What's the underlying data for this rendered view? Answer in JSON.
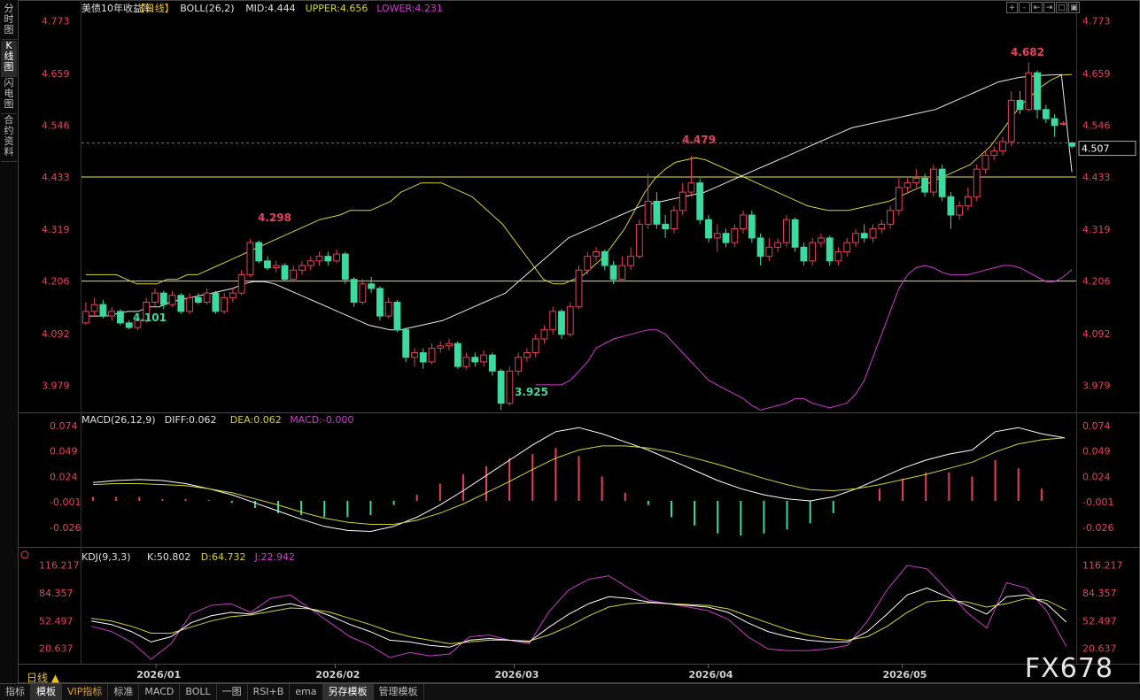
{
  "sidebar": {
    "tabs": [
      "分时图",
      "K线图",
      "闪电图",
      "合约资料"
    ],
    "active": 1
  },
  "main_header": {
    "symbol": "美债10年收益率",
    "period": "【日线】",
    "boll_label": "BOLL(26,2)",
    "mid": "MID:4.444",
    "upper": "UPPER:4.656",
    "lower": "LOWER:4.231"
  },
  "macd_header": {
    "title": "MACD(26,12,9)",
    "diff": "DIFF:0.062",
    "dea": "DEA:0.062",
    "macd": "MACD:-0.000"
  },
  "kdj_header": {
    "title": "KDJ(9,3,3)",
    "k": "K:50.802",
    "d": "D:64.732",
    "j": "J:22.942"
  },
  "toolbar": [
    "+",
    "-",
    "⇤",
    "⇥",
    "□",
    "▣"
  ],
  "price_axis": [
    "4.773",
    "4.659",
    "4.546",
    "4.433",
    "4.319",
    "4.206",
    "4.092",
    "3.979"
  ],
  "macd_axis": [
    "0.074",
    "0.049",
    "0.024",
    "-0.001",
    "-0.026"
  ],
  "kdj_axis": [
    "116.217",
    "84.357",
    "52.497",
    "20.637"
  ],
  "current_price": "4.507",
  "annotations": {
    "high": "4.682",
    "peak_mar": "4.479",
    "peak_jan": "4.298",
    "low_dec": "4.101",
    "low_feb": "3.925"
  },
  "date_labels": [
    "2026/01",
    "2026/02",
    "2026/03",
    "2026/04",
    "2026/05"
  ],
  "bottom_tabs": [
    "指标",
    "模板",
    "VIP指标",
    "标准",
    "MACD",
    "BOLL",
    "一图",
    "RSI+B",
    "ema",
    "另存模板",
    "管理模板"
  ],
  "period_button": "日线 ▲",
  "watermark": "FX678",
  "colors": {
    "up": "#e8405a",
    "down": "#3cd9a0",
    "upper": "#d6d626",
    "mid": "#e8e8e8",
    "lower": "#d03cd0",
    "kdj_j": "#c83cc8",
    "hline": "#e6e640"
  },
  "chart_data": {
    "type": "candlestick",
    "title": "美债10年收益率",
    "period": "日线",
    "ylim": [
      3.92,
      4.78
    ],
    "hlines": [
      4.433,
      4.206
    ],
    "dashed_line": 4.507,
    "candles": [
      [
        4.115,
        4.14,
        4.16,
        4.11
      ],
      [
        4.14,
        4.155,
        4.17,
        4.13
      ],
      [
        4.155,
        4.13,
        4.165,
        4.125
      ],
      [
        4.13,
        4.14,
        4.15,
        4.12
      ],
      [
        4.14,
        4.115,
        4.145,
        4.11
      ],
      [
        4.115,
        4.105,
        4.12,
        4.101
      ],
      [
        4.105,
        4.12,
        4.125,
        4.1
      ],
      [
        4.12,
        4.16,
        4.17,
        4.115
      ],
      [
        4.16,
        4.18,
        4.19,
        4.15
      ],
      [
        4.18,
        4.155,
        4.185,
        4.145
      ],
      [
        4.155,
        4.175,
        4.185,
        4.15
      ],
      [
        4.175,
        4.14,
        4.18,
        4.135
      ],
      [
        4.14,
        4.17,
        4.18,
        4.135
      ],
      [
        4.17,
        4.16,
        4.18,
        4.155
      ],
      [
        4.16,
        4.18,
        4.19,
        4.155
      ],
      [
        4.18,
        4.14,
        4.185,
        4.135
      ],
      [
        4.14,
        4.17,
        4.18,
        4.135
      ],
      [
        4.17,
        4.18,
        4.19,
        4.16
      ],
      [
        4.18,
        4.22,
        4.23,
        4.175
      ],
      [
        4.22,
        4.29,
        4.298,
        4.215
      ],
      [
        4.29,
        4.25,
        4.295,
        4.245
      ],
      [
        4.25,
        4.235,
        4.26,
        4.23
      ],
      [
        4.235,
        4.24,
        4.25,
        4.225
      ],
      [
        4.24,
        4.21,
        4.245,
        4.205
      ],
      [
        4.21,
        4.23,
        4.24,
        4.205
      ],
      [
        4.23,
        4.24,
        4.25,
        4.22
      ],
      [
        4.24,
        4.25,
        4.26,
        4.23
      ],
      [
        4.25,
        4.26,
        4.27,
        4.24
      ],
      [
        4.26,
        4.25,
        4.27,
        4.24
      ],
      [
        4.25,
        4.265,
        4.275,
        4.245
      ],
      [
        4.265,
        4.21,
        4.27,
        4.2
      ],
      [
        4.21,
        4.16,
        4.215,
        4.15
      ],
      [
        4.16,
        4.2,
        4.21,
        4.155
      ],
      [
        4.2,
        4.19,
        4.215,
        4.18
      ],
      [
        4.19,
        4.13,
        4.195,
        4.12
      ],
      [
        4.13,
        4.16,
        4.17,
        4.125
      ],
      [
        4.16,
        4.1,
        4.165,
        4.095
      ],
      [
        4.1,
        4.04,
        4.105,
        4.03
      ],
      [
        4.04,
        4.05,
        4.06,
        4.02
      ],
      [
        4.05,
        4.03,
        4.06,
        4.015
      ],
      [
        4.03,
        4.06,
        4.07,
        4.025
      ],
      [
        4.06,
        4.065,
        4.075,
        4.05
      ],
      [
        4.065,
        4.07,
        4.08,
        4.055
      ],
      [
        4.07,
        4.02,
        4.075,
        4.015
      ],
      [
        4.02,
        4.04,
        4.05,
        4.015
      ],
      [
        4.04,
        4.03,
        4.05,
        4.02
      ],
      [
        4.03,
        4.045,
        4.055,
        4.02
      ],
      [
        4.045,
        4.01,
        4.05,
        4.0
      ],
      [
        4.01,
        3.94,
        4.015,
        3.925
      ],
      [
        3.94,
        4.01,
        4.02,
        3.935
      ],
      [
        4.01,
        4.04,
        4.05,
        4.0
      ],
      [
        4.04,
        4.05,
        4.06,
        4.03
      ],
      [
        4.05,
        4.08,
        4.09,
        4.04
      ],
      [
        4.08,
        4.1,
        4.11,
        4.07
      ],
      [
        4.1,
        4.14,
        4.15,
        4.09
      ],
      [
        4.14,
        4.09,
        4.145,
        4.08
      ],
      [
        4.09,
        4.15,
        4.16,
        4.085
      ],
      [
        4.15,
        4.23,
        4.24,
        4.145
      ],
      [
        4.23,
        4.26,
        4.27,
        4.22
      ],
      [
        4.26,
        4.27,
        4.28,
        4.25
      ],
      [
        4.27,
        4.24,
        4.275,
        4.23
      ],
      [
        4.24,
        4.21,
        4.25,
        4.2
      ],
      [
        4.21,
        4.24,
        4.26,
        4.205
      ],
      [
        4.24,
        4.26,
        4.28,
        4.23
      ],
      [
        4.26,
        4.33,
        4.34,
        4.255
      ],
      [
        4.33,
        4.38,
        4.44,
        4.32
      ],
      [
        4.38,
        4.33,
        4.4,
        4.32
      ],
      [
        4.33,
        4.32,
        4.35,
        4.3
      ],
      [
        4.32,
        4.36,
        4.37,
        4.31
      ],
      [
        4.36,
        4.4,
        4.42,
        4.35
      ],
      [
        4.4,
        4.42,
        4.479,
        4.39
      ],
      [
        4.42,
        4.34,
        4.43,
        4.33
      ],
      [
        4.34,
        4.3,
        4.35,
        4.29
      ],
      [
        4.3,
        4.31,
        4.33,
        4.27
      ],
      [
        4.31,
        4.29,
        4.32,
        4.28
      ],
      [
        4.29,
        4.32,
        4.33,
        4.28
      ],
      [
        4.32,
        4.35,
        4.36,
        4.31
      ],
      [
        4.35,
        4.3,
        4.36,
        4.29
      ],
      [
        4.3,
        4.26,
        4.31,
        4.24
      ],
      [
        4.26,
        4.28,
        4.3,
        4.25
      ],
      [
        4.28,
        4.29,
        4.3,
        4.27
      ],
      [
        4.29,
        4.34,
        4.35,
        4.28
      ],
      [
        4.34,
        4.28,
        4.345,
        4.27
      ],
      [
        4.28,
        4.25,
        4.29,
        4.24
      ],
      [
        4.25,
        4.29,
        4.3,
        4.24
      ],
      [
        4.29,
        4.3,
        4.31,
        4.28
      ],
      [
        4.3,
        4.25,
        4.305,
        4.24
      ],
      [
        4.25,
        4.27,
        4.28,
        4.24
      ],
      [
        4.27,
        4.29,
        4.3,
        4.26
      ],
      [
        4.29,
        4.31,
        4.32,
        4.28
      ],
      [
        4.31,
        4.3,
        4.33,
        4.29
      ],
      [
        4.3,
        4.32,
        4.33,
        4.29
      ],
      [
        4.32,
        4.33,
        4.34,
        4.31
      ],
      [
        4.33,
        4.36,
        4.37,
        4.32
      ],
      [
        4.36,
        4.41,
        4.43,
        4.35
      ],
      [
        4.41,
        4.42,
        4.43,
        4.4
      ],
      [
        4.42,
        4.43,
        4.45,
        4.41
      ],
      [
        4.43,
        4.4,
        4.44,
        4.39
      ],
      [
        4.4,
        4.45,
        4.46,
        4.39
      ],
      [
        4.45,
        4.39,
        4.46,
        4.38
      ],
      [
        4.39,
        4.35,
        4.4,
        4.32
      ],
      [
        4.35,
        4.37,
        4.38,
        4.34
      ],
      [
        4.37,
        4.39,
        4.41,
        4.36
      ],
      [
        4.39,
        4.45,
        4.46,
        4.38
      ],
      [
        4.45,
        4.48,
        4.49,
        4.44
      ],
      [
        4.48,
        4.49,
        4.5,
        4.47
      ],
      [
        4.49,
        4.51,
        4.52,
        4.48
      ],
      [
        4.51,
        4.6,
        4.62,
        4.5
      ],
      [
        4.6,
        4.58,
        4.62,
        4.57
      ],
      [
        4.58,
        4.66,
        4.682,
        4.575
      ],
      [
        4.66,
        4.58,
        4.665,
        4.56
      ],
      [
        4.58,
        4.56,
        4.59,
        4.55
      ],
      [
        4.56,
        4.545,
        4.57,
        4.52
      ],
      [
        4.55,
        4.55,
        4.555,
        4.545
      ],
      [
        4.507,
        4.5,
        4.51,
        4.495
      ]
    ],
    "boll_upper": [
      4.22,
      4.22,
      4.22,
      4.22,
      4.21,
      4.2,
      4.2,
      4.2,
      4.21,
      4.21,
      4.22,
      4.22,
      4.23,
      4.24,
      4.25,
      4.26,
      4.27,
      4.28,
      4.29,
      4.3,
      4.31,
      4.32,
      4.33,
      4.34,
      4.345,
      4.35,
      4.36,
      4.36,
      4.36,
      4.37,
      4.38,
      4.4,
      4.41,
      4.42,
      4.42,
      4.42,
      4.41,
      4.4,
      4.39,
      4.37,
      4.35,
      4.33,
      4.3,
      4.27,
      4.24,
      4.21,
      4.2,
      4.2,
      4.21,
      4.22,
      4.24,
      4.26,
      4.29,
      4.32,
      4.36,
      4.4,
      4.43,
      4.45,
      4.465,
      4.47,
      4.475,
      4.47,
      4.46,
      4.45,
      4.44,
      4.43,
      4.42,
      4.41,
      4.4,
      4.39,
      4.38,
      4.37,
      4.365,
      4.36,
      4.36,
      4.36,
      4.365,
      4.37,
      4.375,
      4.38,
      4.39,
      4.4,
      4.41,
      4.42,
      4.43,
      4.44,
      4.45,
      4.46,
      4.48,
      4.5,
      4.53,
      4.56,
      4.59,
      4.61,
      4.63,
      4.645,
      4.655,
      4.656
    ],
    "boll_mid": [
      4.13,
      4.13,
      4.13,
      4.135,
      4.14,
      4.14,
      4.15,
      4.15,
      4.16,
      4.165,
      4.17,
      4.175,
      4.18,
      4.185,
      4.19,
      4.2,
      4.205,
      4.205,
      4.2,
      4.19,
      4.18,
      4.17,
      4.16,
      4.15,
      4.14,
      4.13,
      4.12,
      4.11,
      4.105,
      4.1,
      4.1,
      4.105,
      4.11,
      4.115,
      4.12,
      4.13,
      4.14,
      4.15,
      4.16,
      4.17,
      4.18,
      4.2,
      4.22,
      4.24,
      4.26,
      4.28,
      4.3,
      4.31,
      4.32,
      4.33,
      4.34,
      4.35,
      4.36,
      4.37,
      4.375,
      4.38,
      4.385,
      4.39,
      4.395,
      4.4,
      4.41,
      4.42,
      4.43,
      4.44,
      4.45,
      4.46,
      4.47,
      4.48,
      4.49,
      4.5,
      4.51,
      4.52,
      4.53,
      4.54,
      4.545,
      4.55,
      4.555,
      4.56,
      4.565,
      4.57,
      4.575,
      4.58,
      4.59,
      4.6,
      4.61,
      4.62,
      4.63,
      4.64,
      4.645,
      4.65,
      4.652,
      4.654,
      4.655,
      4.656,
      4.444
    ],
    "boll_lower": [
      3.98,
      3.98,
      3.98,
      3.98,
      3.99,
      4.01,
      4.03,
      4.06,
      4.07,
      4.08,
      4.085,
      4.09,
      4.095,
      4.1,
      4.1,
      4.09,
      4.07,
      4.05,
      4.03,
      4.01,
      3.99,
      3.98,
      3.97,
      3.96,
      3.95,
      3.935,
      3.925,
      3.93,
      3.935,
      3.94,
      3.95,
      3.95,
      3.94,
      3.935,
      3.93,
      3.935,
      3.94,
      3.96,
      3.99,
      4.04,
      4.09,
      4.14,
      4.19,
      4.22,
      4.235,
      4.24,
      4.235,
      4.225,
      4.22,
      4.22,
      4.22,
      4.225,
      4.23,
      4.235,
      4.24,
      4.24,
      4.235,
      4.225,
      4.215,
      4.205,
      4.205,
      4.215,
      4.231
    ],
    "macd_diff": [
      0.018,
      0.02,
      0.021,
      0.02,
      0.017,
      0.012,
      0.006,
      -0.002,
      -0.01,
      -0.018,
      -0.025,
      -0.029,
      -0.03,
      -0.025,
      -0.016,
      -0.004,
      0.01,
      0.025,
      0.04,
      0.055,
      0.068,
      0.072,
      0.066,
      0.058,
      0.05,
      0.04,
      0.03,
      0.02,
      0.012,
      0.006,
      0.002,
      0.0,
      0.004,
      0.012,
      0.022,
      0.032,
      0.04,
      0.046,
      0.05,
      0.068,
      0.072,
      0.066,
      0.062
    ],
    "macd_dea": [
      0.016,
      0.017,
      0.017,
      0.016,
      0.015,
      0.012,
      0.008,
      0.002,
      -0.004,
      -0.011,
      -0.017,
      -0.021,
      -0.023,
      -0.023,
      -0.019,
      -0.012,
      -0.003,
      0.008,
      0.019,
      0.031,
      0.042,
      0.05,
      0.054,
      0.054,
      0.052,
      0.048,
      0.042,
      0.036,
      0.029,
      0.022,
      0.016,
      0.011,
      0.01,
      0.012,
      0.016,
      0.021,
      0.026,
      0.032,
      0.038,
      0.048,
      0.056,
      0.06,
      0.062
    ],
    "macd_hist": [
      0.004,
      0.004,
      0.004,
      0.002,
      0.002,
      0.001,
      -0.002,
      -0.007,
      -0.012,
      -0.014,
      -0.016,
      -0.016,
      -0.014,
      -0.004,
      0.006,
      0.017,
      0.026,
      0.034,
      0.042,
      0.046,
      0.052,
      0.044,
      0.024,
      0.008,
      -0.004,
      -0.016,
      -0.024,
      -0.032,
      -0.034,
      -0.032,
      -0.028,
      -0.022,
      -0.012,
      0.0,
      0.012,
      0.022,
      0.028,
      0.028,
      0.024,
      0.04,
      0.032,
      0.012,
      -0.0
    ],
    "kdj_k": [
      52,
      48,
      40,
      28,
      34,
      50,
      58,
      62,
      60,
      68,
      72,
      66,
      58,
      48,
      40,
      30,
      28,
      24,
      22,
      30,
      32,
      30,
      28,
      45,
      60,
      72,
      80,
      78,
      74,
      72,
      70,
      68,
      62,
      50,
      40,
      34,
      30,
      28,
      28,
      40,
      60,
      82,
      90,
      80,
      70,
      60,
      80,
      82,
      72,
      50.8
    ],
    "kdj_d": [
      55,
      52,
      46,
      38,
      38,
      45,
      52,
      57,
      59,
      63,
      67,
      66,
      62,
      55,
      48,
      40,
      34,
      30,
      26,
      28,
      30,
      30,
      29,
      36,
      46,
      58,
      68,
      72,
      73,
      72,
      71,
      70,
      66,
      58,
      50,
      42,
      36,
      32,
      30,
      34,
      46,
      62,
      74,
      76,
      74,
      68,
      72,
      78,
      76,
      64.7
    ],
    "kdj_j": [
      46,
      40,
      28,
      8,
      26,
      60,
      70,
      72,
      62,
      78,
      82,
      66,
      50,
      34,
      24,
      10,
      16,
      12,
      14,
      34,
      36,
      30,
      26,
      63,
      88,
      100,
      104,
      90,
      76,
      72,
      68,
      64,
      54,
      34,
      20,
      18,
      18,
      20,
      24,
      52,
      88,
      116,
      112,
      88,
      62,
      44,
      96,
      90,
      64,
      22.9
    ]
  }
}
